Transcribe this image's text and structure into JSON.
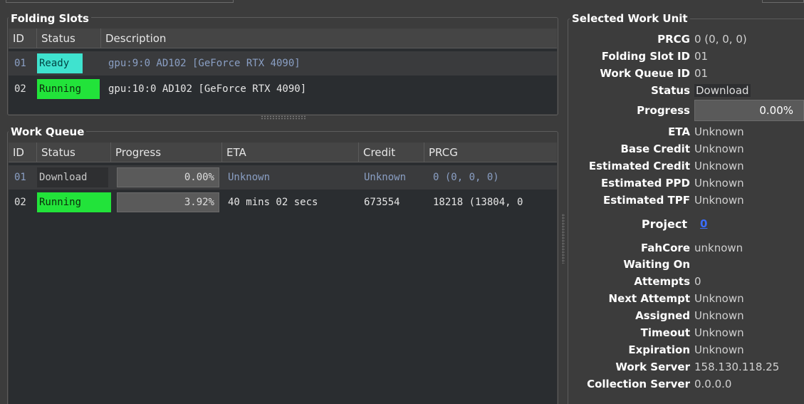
{
  "folding_slots": {
    "title": "Folding Slots",
    "columns": [
      "ID",
      "Status",
      "Description"
    ],
    "rows": [
      {
        "id": "01",
        "status": "Ready",
        "description": "gpu:9:0 AD102 [GeForce RTX 4090]"
      },
      {
        "id": "02",
        "status": "Running",
        "description": "gpu:10:0 AD102 [GeForce RTX 4090]"
      }
    ]
  },
  "work_queue": {
    "title": "Work Queue",
    "columns": [
      "ID",
      "Status",
      "Progress",
      "ETA",
      "Credit",
      "PRCG"
    ],
    "rows": [
      {
        "id": "01",
        "status": "Download",
        "progress": "0.00%",
        "progress_fraction": 0.0,
        "eta": "Unknown",
        "credit": "Unknown",
        "prcg": "0 (0, 0, 0)"
      },
      {
        "id": "02",
        "status": "Running",
        "progress": "3.92%",
        "progress_fraction": 0.0392,
        "eta": "40 mins 02 secs",
        "credit": "673554",
        "prcg": "18218 (13804, 0"
      }
    ]
  },
  "selected_work_unit": {
    "title": "Selected Work Unit",
    "prcg_label": "PRCG",
    "prcg": "0 (0, 0, 0)",
    "folding_slot_id_label": "Folding Slot ID",
    "folding_slot_id": "01",
    "work_queue_id_label": "Work Queue ID",
    "work_queue_id": "01",
    "status_label": "Status",
    "status": "Download",
    "progress_label": "Progress",
    "progress": "0.00%",
    "eta_label": "ETA",
    "eta": "Unknown",
    "base_credit_label": "Base Credit",
    "base_credit": "Unknown",
    "estimated_credit_label": "Estimated Credit",
    "estimated_credit": "Unknown",
    "estimated_ppd_label": "Estimated PPD",
    "estimated_ppd": "Unknown",
    "estimated_tpf_label": "Estimated TPF",
    "estimated_tpf": "Unknown",
    "project_label": "Project",
    "project": "0",
    "fahcore_label": "FahCore",
    "fahcore": "unknown",
    "waiting_on_label": "Waiting On",
    "waiting_on": "",
    "attempts_label": "Attempts",
    "attempts": "0",
    "next_attempt_label": "Next Attempt",
    "next_attempt": "Unknown",
    "assigned_label": "Assigned",
    "assigned": "Unknown",
    "timeout_label": "Timeout",
    "timeout": "Unknown",
    "expiration_label": "Expiration",
    "expiration": "Unknown",
    "work_server_label": "Work Server",
    "work_server": "158.130.118.25",
    "collection_server_label": "Collection Server",
    "collection_server": "0.0.0.0"
  },
  "colors": {
    "ready": "#3fe3cf",
    "running": "#22e33a",
    "link": "#3b6dff",
    "row_text": "#8a9fc4"
  }
}
